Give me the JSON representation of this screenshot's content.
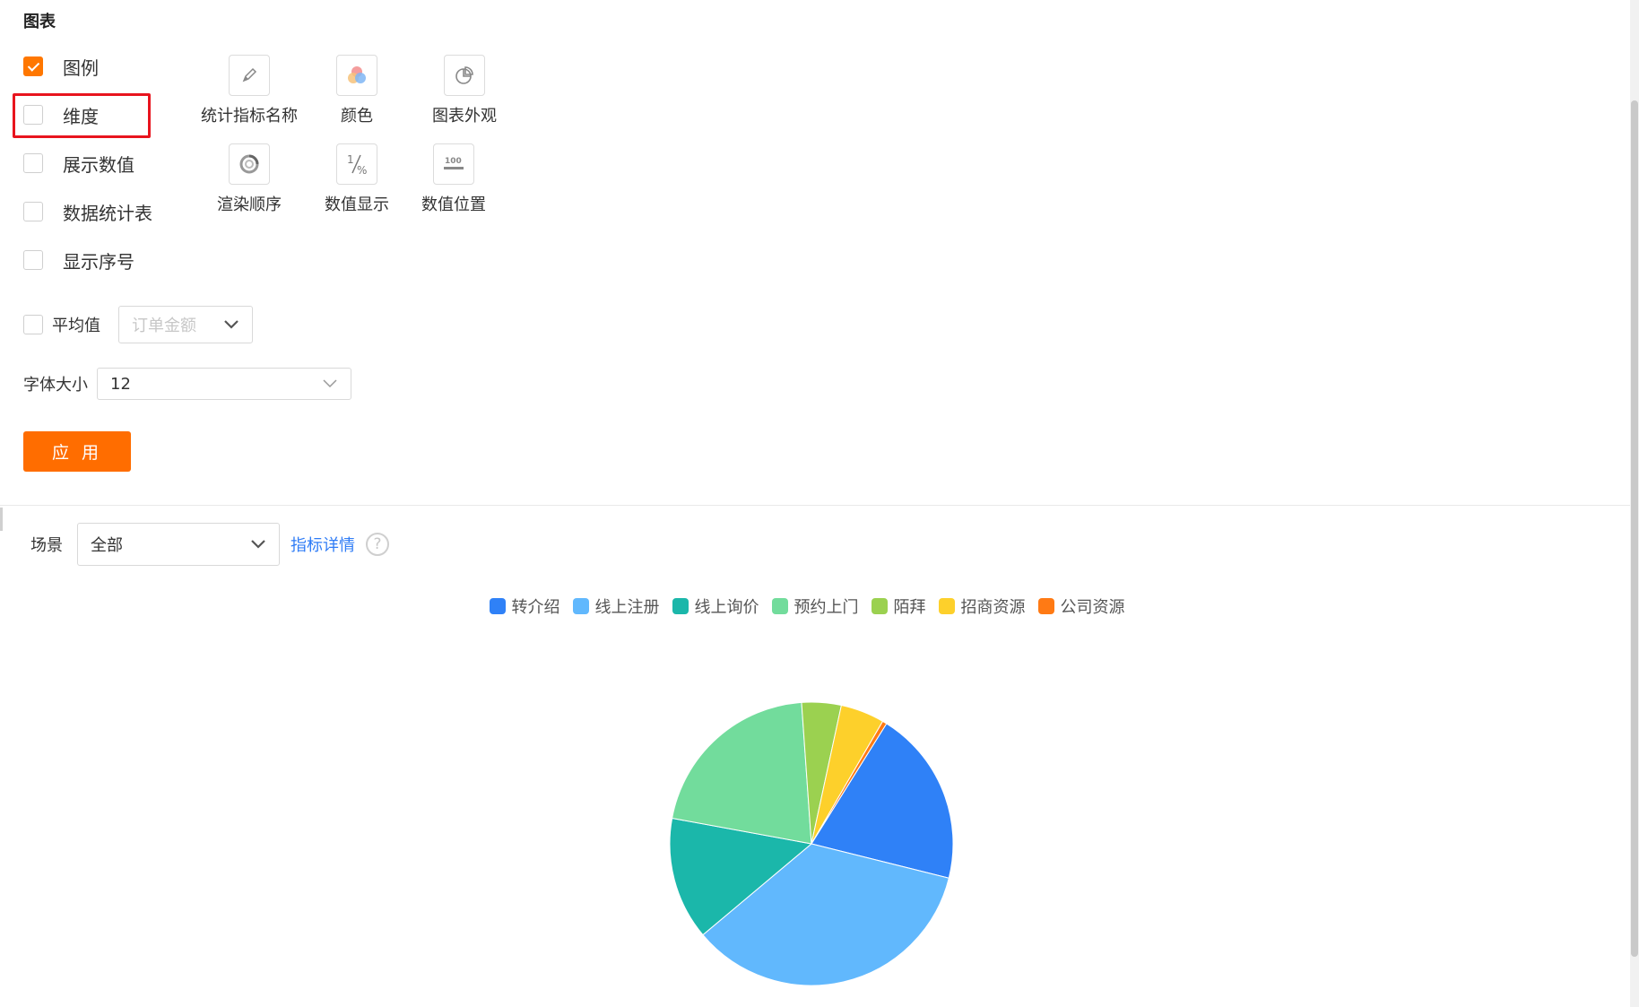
{
  "panel": {
    "title": "图表",
    "options": [
      {
        "label": "图例",
        "checked": true
      },
      {
        "label": "维度",
        "checked": false
      },
      {
        "label": "展示数值",
        "checked": false
      },
      {
        "label": "数据统计表",
        "checked": false
      },
      {
        "label": "显示序号",
        "checked": false
      }
    ],
    "tools": [
      {
        "label": "统计指标名称",
        "icon": "pencil-icon"
      },
      {
        "label": "颜色",
        "icon": "color-palette-icon"
      },
      {
        "label": "图表外观",
        "icon": "pie-chart-icon"
      },
      {
        "label": "渲染顺序",
        "icon": "render-order-icon"
      },
      {
        "label": "数值显示",
        "icon": "percent-icon"
      },
      {
        "label": "数值位置",
        "icon": "value-position-icon"
      }
    ],
    "average": {
      "label": "平均值",
      "checked": false,
      "placeholder": "订单金额"
    },
    "font_size": {
      "label": "字体大小",
      "value": "12"
    },
    "apply_label": "应 用"
  },
  "filter": {
    "scene_label": "场景",
    "scene_value": "全部",
    "detail_link": "指标详情",
    "help_glyph": "?"
  },
  "chart_data": {
    "type": "pie",
    "categories": [
      "转介绍",
      "线上注册",
      "线上询价",
      "预约上门",
      "陌拜",
      "招商资源",
      "公司资源"
    ],
    "values": [
      20,
      35,
      14,
      21,
      4.5,
      5,
      0.5
    ],
    "colors": [
      "#2f81f7",
      "#61b8fd",
      "#1bb7aa",
      "#72dc9c",
      "#9bd150",
      "#fdd02b",
      "#ff7a14"
    ],
    "legend_position": "top-center"
  }
}
